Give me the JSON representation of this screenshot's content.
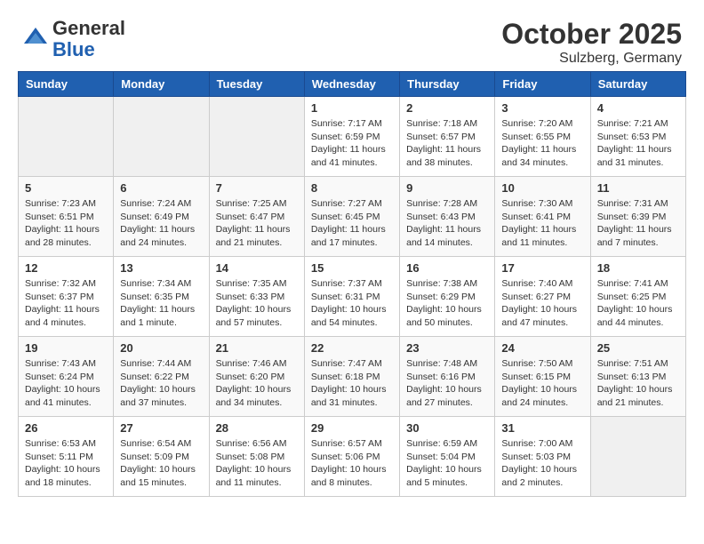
{
  "header": {
    "logo_line1": "General",
    "logo_line2": "Blue",
    "month": "October 2025",
    "location": "Sulzberg, Germany"
  },
  "days_of_week": [
    "Sunday",
    "Monday",
    "Tuesday",
    "Wednesday",
    "Thursday",
    "Friday",
    "Saturday"
  ],
  "weeks": [
    [
      {
        "day": "",
        "empty": true
      },
      {
        "day": "",
        "empty": true
      },
      {
        "day": "",
        "empty": true
      },
      {
        "day": "1",
        "sunrise": "Sunrise: 7:17 AM",
        "sunset": "Sunset: 6:59 PM",
        "daylight": "Daylight: 11 hours and 41 minutes."
      },
      {
        "day": "2",
        "sunrise": "Sunrise: 7:18 AM",
        "sunset": "Sunset: 6:57 PM",
        "daylight": "Daylight: 11 hours and 38 minutes."
      },
      {
        "day": "3",
        "sunrise": "Sunrise: 7:20 AM",
        "sunset": "Sunset: 6:55 PM",
        "daylight": "Daylight: 11 hours and 34 minutes."
      },
      {
        "day": "4",
        "sunrise": "Sunrise: 7:21 AM",
        "sunset": "Sunset: 6:53 PM",
        "daylight": "Daylight: 11 hours and 31 minutes."
      }
    ],
    [
      {
        "day": "5",
        "sunrise": "Sunrise: 7:23 AM",
        "sunset": "Sunset: 6:51 PM",
        "daylight": "Daylight: 11 hours and 28 minutes."
      },
      {
        "day": "6",
        "sunrise": "Sunrise: 7:24 AM",
        "sunset": "Sunset: 6:49 PM",
        "daylight": "Daylight: 11 hours and 24 minutes."
      },
      {
        "day": "7",
        "sunrise": "Sunrise: 7:25 AM",
        "sunset": "Sunset: 6:47 PM",
        "daylight": "Daylight: 11 hours and 21 minutes."
      },
      {
        "day": "8",
        "sunrise": "Sunrise: 7:27 AM",
        "sunset": "Sunset: 6:45 PM",
        "daylight": "Daylight: 11 hours and 17 minutes."
      },
      {
        "day": "9",
        "sunrise": "Sunrise: 7:28 AM",
        "sunset": "Sunset: 6:43 PM",
        "daylight": "Daylight: 11 hours and 14 minutes."
      },
      {
        "day": "10",
        "sunrise": "Sunrise: 7:30 AM",
        "sunset": "Sunset: 6:41 PM",
        "daylight": "Daylight: 11 hours and 11 minutes."
      },
      {
        "day": "11",
        "sunrise": "Sunrise: 7:31 AM",
        "sunset": "Sunset: 6:39 PM",
        "daylight": "Daylight: 11 hours and 7 minutes."
      }
    ],
    [
      {
        "day": "12",
        "sunrise": "Sunrise: 7:32 AM",
        "sunset": "Sunset: 6:37 PM",
        "daylight": "Daylight: 11 hours and 4 minutes."
      },
      {
        "day": "13",
        "sunrise": "Sunrise: 7:34 AM",
        "sunset": "Sunset: 6:35 PM",
        "daylight": "Daylight: 11 hours and 1 minute."
      },
      {
        "day": "14",
        "sunrise": "Sunrise: 7:35 AM",
        "sunset": "Sunset: 6:33 PM",
        "daylight": "Daylight: 10 hours and 57 minutes."
      },
      {
        "day": "15",
        "sunrise": "Sunrise: 7:37 AM",
        "sunset": "Sunset: 6:31 PM",
        "daylight": "Daylight: 10 hours and 54 minutes."
      },
      {
        "day": "16",
        "sunrise": "Sunrise: 7:38 AM",
        "sunset": "Sunset: 6:29 PM",
        "daylight": "Daylight: 10 hours and 50 minutes."
      },
      {
        "day": "17",
        "sunrise": "Sunrise: 7:40 AM",
        "sunset": "Sunset: 6:27 PM",
        "daylight": "Daylight: 10 hours and 47 minutes."
      },
      {
        "day": "18",
        "sunrise": "Sunrise: 7:41 AM",
        "sunset": "Sunset: 6:25 PM",
        "daylight": "Daylight: 10 hours and 44 minutes."
      }
    ],
    [
      {
        "day": "19",
        "sunrise": "Sunrise: 7:43 AM",
        "sunset": "Sunset: 6:24 PM",
        "daylight": "Daylight: 10 hours and 41 minutes."
      },
      {
        "day": "20",
        "sunrise": "Sunrise: 7:44 AM",
        "sunset": "Sunset: 6:22 PM",
        "daylight": "Daylight: 10 hours and 37 minutes."
      },
      {
        "day": "21",
        "sunrise": "Sunrise: 7:46 AM",
        "sunset": "Sunset: 6:20 PM",
        "daylight": "Daylight: 10 hours and 34 minutes."
      },
      {
        "day": "22",
        "sunrise": "Sunrise: 7:47 AM",
        "sunset": "Sunset: 6:18 PM",
        "daylight": "Daylight: 10 hours and 31 minutes."
      },
      {
        "day": "23",
        "sunrise": "Sunrise: 7:48 AM",
        "sunset": "Sunset: 6:16 PM",
        "daylight": "Daylight: 10 hours and 27 minutes."
      },
      {
        "day": "24",
        "sunrise": "Sunrise: 7:50 AM",
        "sunset": "Sunset: 6:15 PM",
        "daylight": "Daylight: 10 hours and 24 minutes."
      },
      {
        "day": "25",
        "sunrise": "Sunrise: 7:51 AM",
        "sunset": "Sunset: 6:13 PM",
        "daylight": "Daylight: 10 hours and 21 minutes."
      }
    ],
    [
      {
        "day": "26",
        "sunrise": "Sunrise: 6:53 AM",
        "sunset": "Sunset: 5:11 PM",
        "daylight": "Daylight: 10 hours and 18 minutes."
      },
      {
        "day": "27",
        "sunrise": "Sunrise: 6:54 AM",
        "sunset": "Sunset: 5:09 PM",
        "daylight": "Daylight: 10 hours and 15 minutes."
      },
      {
        "day": "28",
        "sunrise": "Sunrise: 6:56 AM",
        "sunset": "Sunset: 5:08 PM",
        "daylight": "Daylight: 10 hours and 11 minutes."
      },
      {
        "day": "29",
        "sunrise": "Sunrise: 6:57 AM",
        "sunset": "Sunset: 5:06 PM",
        "daylight": "Daylight: 10 hours and 8 minutes."
      },
      {
        "day": "30",
        "sunrise": "Sunrise: 6:59 AM",
        "sunset": "Sunset: 5:04 PM",
        "daylight": "Daylight: 10 hours and 5 minutes."
      },
      {
        "day": "31",
        "sunrise": "Sunrise: 7:00 AM",
        "sunset": "Sunset: 5:03 PM",
        "daylight": "Daylight: 10 hours and 2 minutes."
      },
      {
        "day": "",
        "empty": true
      }
    ]
  ]
}
